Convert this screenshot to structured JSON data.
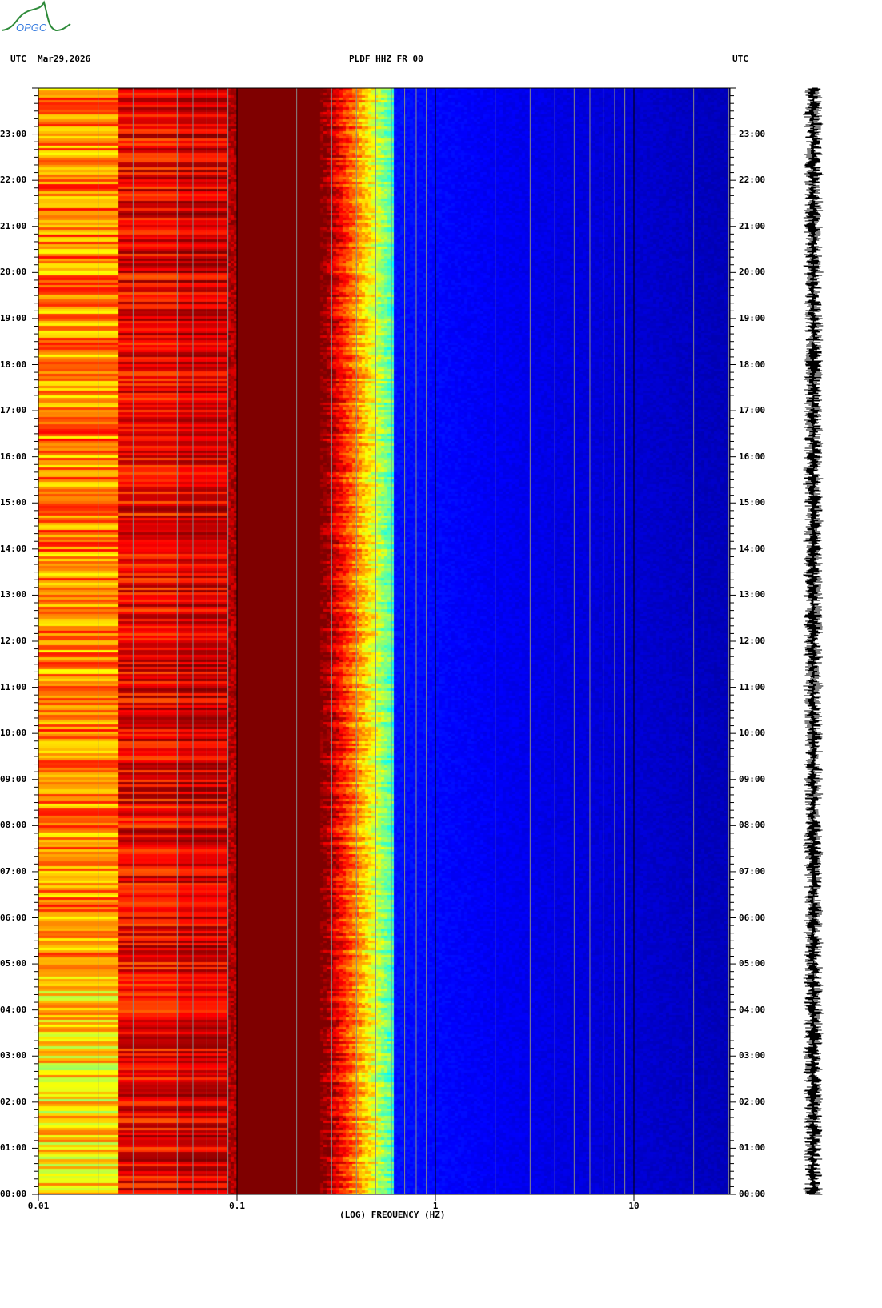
{
  "header": {
    "left_tz": "UTC",
    "date": "Mar29,2026",
    "station": "PLDF HHZ FR 00",
    "right_tz": "UTC"
  },
  "logo_text": "OPGC",
  "colors": {
    "low": "#00008b",
    "high": "#8b0000"
  },
  "chart_data": {
    "type": "heatmap",
    "title": "PLDF HHZ FR 00",
    "xlabel": "(LOG) FREQUENCY (HZ)",
    "ylabel": "UTC",
    "xscale": "log",
    "xlim": [
      0.01,
      30
    ],
    "x_ticks": [
      "0.01",
      "0.1",
      "1",
      "10"
    ],
    "x_tick_values": [
      0.01,
      0.1,
      1,
      10
    ],
    "y_ticks": [
      "00:00",
      "01:00",
      "02:00",
      "03:00",
      "04:00",
      "05:00",
      "06:00",
      "07:00",
      "08:00",
      "09:00",
      "10:00",
      "11:00",
      "12:00",
      "13:00",
      "14:00",
      "15:00",
      "16:00",
      "17:00",
      "18:00",
      "19:00",
      "20:00",
      "21:00",
      "22:00",
      "23:00"
    ],
    "ylim_hours": [
      0,
      24
    ],
    "description_bands": [
      {
        "fmin": 0.01,
        "fmax": 0.025,
        "level": "yellow-red"
      },
      {
        "fmin": 0.025,
        "fmax": 0.1,
        "level": "red"
      },
      {
        "fmin": 0.1,
        "fmax": 0.27,
        "level": "dark red"
      },
      {
        "fmin": 0.27,
        "fmax": 0.6,
        "level": "yellow-cyan transition"
      },
      {
        "fmin": 0.6,
        "fmax": 30,
        "level": "blue"
      }
    ]
  }
}
